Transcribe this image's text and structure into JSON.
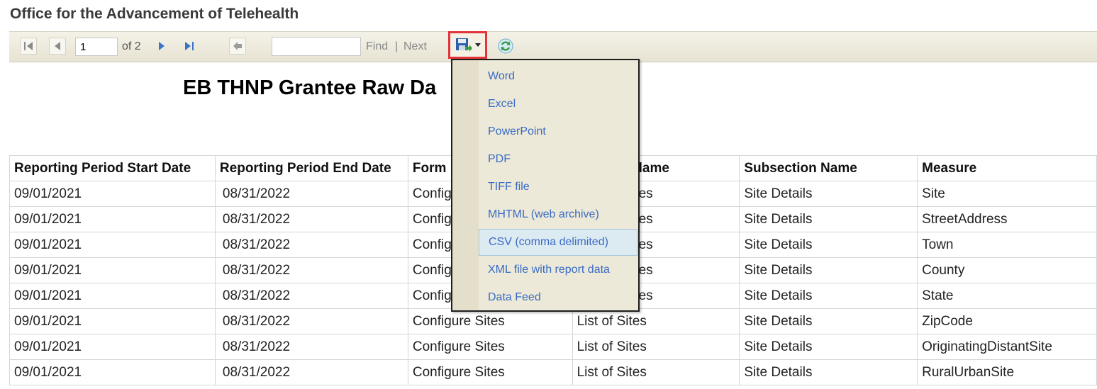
{
  "app": {
    "title": "Office for the Advancement of Telehealth"
  },
  "toolbar": {
    "page_current": "1",
    "page_of": "of 2",
    "find_value": "",
    "find_label": "Find",
    "separator": "|",
    "next_label": "Next",
    "icons": {
      "first": "first-page-icon",
      "prev": "previous-page-icon",
      "next": "next-page-icon",
      "last": "last-page-icon",
      "back": "back-to-parent-icon",
      "export": "save-disk-icon",
      "refresh": "refresh-icon"
    }
  },
  "report": {
    "title": "EB THNP Grantee Raw Da"
  },
  "export_menu": {
    "items": [
      {
        "label": "Word"
      },
      {
        "label": "Excel"
      },
      {
        "label": "PowerPoint"
      },
      {
        "label": "PDF"
      },
      {
        "label": "TIFF file"
      },
      {
        "label": "MHTML (web archive)"
      },
      {
        "label": "CSV (comma delimited)",
        "hover": true
      },
      {
        "label": "XML file with report data"
      },
      {
        "label": "Data Feed"
      }
    ]
  },
  "table": {
    "headers": [
      "Reporting Period Start Date",
      "Reporting Period End Date",
      "Form",
      "lame",
      "Subsection Name",
      "Measure"
    ],
    "rows": [
      [
        "09/01/2021",
        "08/31/2022",
        "Config",
        "es",
        "Site Details",
        "Site"
      ],
      [
        "09/01/2021",
        "08/31/2022",
        "Config",
        "es",
        "Site Details",
        "StreetAddress"
      ],
      [
        "09/01/2021",
        "08/31/2022",
        "Config",
        "es",
        "Site Details",
        "Town"
      ],
      [
        "09/01/2021",
        "08/31/2022",
        "Config",
        "es",
        "Site Details",
        "County"
      ],
      [
        "09/01/2021",
        "08/31/2022",
        "Config",
        "es",
        "Site Details",
        "State"
      ],
      [
        "09/01/2021",
        "08/31/2022",
        "Configure Sites",
        "List of Sites",
        "Site Details",
        "ZipCode"
      ],
      [
        "09/01/2021",
        "08/31/2022",
        "Configure Sites",
        "List of Sites",
        "Site Details",
        "OriginatingDistantSite"
      ],
      [
        "09/01/2021",
        "08/31/2022",
        "Configure Sites",
        "List of Sites",
        "Site Details",
        "RuralUrbanSite"
      ]
    ]
  },
  "colors": {
    "toolbar_bg": "#ece9d8",
    "menu_link": "#3b6bc4",
    "highlight_border": "#e3343a",
    "menu_hover": "#dceaf2"
  }
}
